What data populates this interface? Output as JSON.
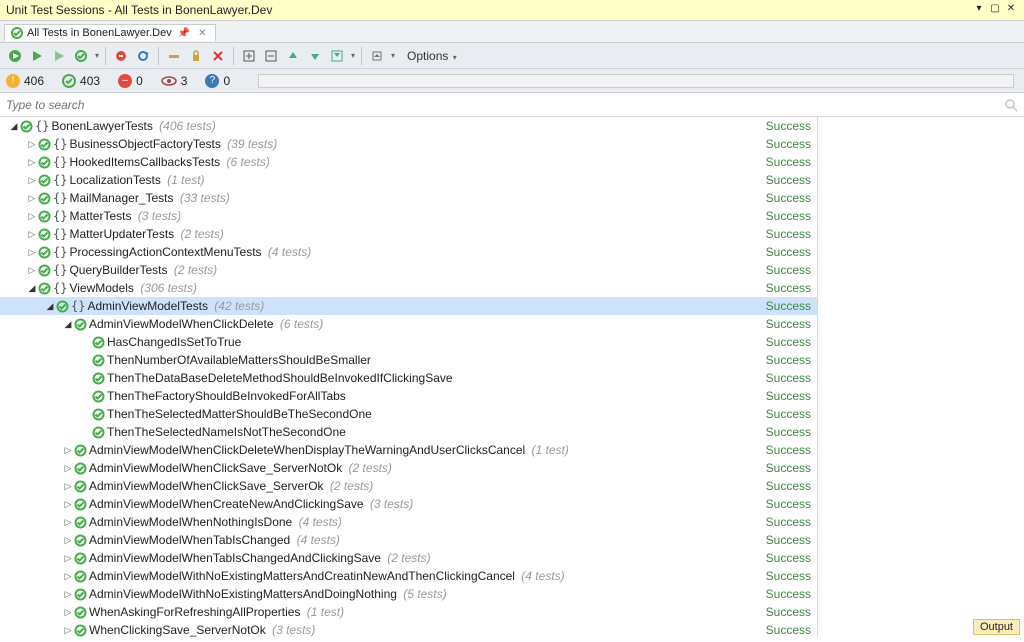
{
  "window_title": "Unit Test Sessions - All Tests in BonenLawyer.Dev",
  "tab_label": "All Tests in BonenLawyer.Dev",
  "options_label": "Options",
  "search_placeholder": "Type to search",
  "status": {
    "warnings": "406",
    "passed": "403",
    "failed": "0",
    "ignored": "3",
    "inconclusive": "0"
  },
  "success_label": "Success",
  "output_label": "Output",
  "tree": [
    {
      "depth": 0,
      "exp": "down",
      "brace": true,
      "name": "BonenLawyerTests",
      "count": "(406 tests)",
      "status": true
    },
    {
      "depth": 1,
      "exp": "right",
      "brace": true,
      "name": "BusinessObjectFactoryTests",
      "count": "(39 tests)",
      "status": true
    },
    {
      "depth": 1,
      "exp": "right",
      "brace": true,
      "name": "HookedItemsCallbacksTests",
      "count": "(6 tests)",
      "status": true
    },
    {
      "depth": 1,
      "exp": "right",
      "brace": true,
      "name": "LocalizationTests",
      "count": "(1 test)",
      "status": true
    },
    {
      "depth": 1,
      "exp": "right",
      "brace": true,
      "name": "MailManager_Tests",
      "count": "(33 tests)",
      "status": true
    },
    {
      "depth": 1,
      "exp": "right",
      "brace": true,
      "name": "MatterTests",
      "count": "(3 tests)",
      "status": true
    },
    {
      "depth": 1,
      "exp": "right",
      "brace": true,
      "name": "MatterUpdaterTests",
      "count": "(2 tests)",
      "status": true
    },
    {
      "depth": 1,
      "exp": "right",
      "brace": true,
      "name": "ProcessingActionContextMenuTests",
      "count": "(4 tests)",
      "status": true
    },
    {
      "depth": 1,
      "exp": "right",
      "brace": true,
      "name": "QueryBuilderTests",
      "count": "(2 tests)",
      "status": true
    },
    {
      "depth": 1,
      "exp": "down",
      "brace": true,
      "name": "ViewModels",
      "count": "(306 tests)",
      "status": true
    },
    {
      "depth": 2,
      "exp": "down",
      "brace": true,
      "name": "AdminViewModelTests",
      "count": "(42 tests)",
      "status": true,
      "selected": true
    },
    {
      "depth": 3,
      "exp": "down",
      "brace": false,
      "name": "AdminViewModelWhenClickDelete",
      "count": "(6 tests)",
      "status": true
    },
    {
      "depth": 4,
      "exp": "",
      "brace": false,
      "name": "HasChangedIsSetToTrue",
      "count": "",
      "status": true
    },
    {
      "depth": 4,
      "exp": "",
      "brace": false,
      "name": "ThenNumberOfAvailableMattersShouldBeSmaller",
      "count": "",
      "status": true
    },
    {
      "depth": 4,
      "exp": "",
      "brace": false,
      "name": "ThenTheDataBaseDeleteMethodShouldBeInvokedIfClickingSave",
      "count": "",
      "status": true
    },
    {
      "depth": 4,
      "exp": "",
      "brace": false,
      "name": "ThenTheFactoryShouldBeInvokedForAllTabs",
      "count": "",
      "status": true
    },
    {
      "depth": 4,
      "exp": "",
      "brace": false,
      "name": "ThenTheSelectedMatterShouldBeTheSecondOne",
      "count": "",
      "status": true
    },
    {
      "depth": 4,
      "exp": "",
      "brace": false,
      "name": "ThenTheSelectedNameIsNotTheSecondOne",
      "count": "",
      "status": true
    },
    {
      "depth": 3,
      "exp": "right",
      "brace": false,
      "name": "AdminViewModelWhenClickDeleteWhenDisplayTheWarningAndUserClicksCancel",
      "count": "(1 test)",
      "status": true
    },
    {
      "depth": 3,
      "exp": "right",
      "brace": false,
      "name": "AdminViewModelWhenClickSave_ServerNotOk",
      "count": "(2 tests)",
      "status": true
    },
    {
      "depth": 3,
      "exp": "right",
      "brace": false,
      "name": "AdminViewModelWhenClickSave_ServerOk",
      "count": "(2 tests)",
      "status": true
    },
    {
      "depth": 3,
      "exp": "right",
      "brace": false,
      "name": "AdminViewModelWhenCreateNewAndClickingSave",
      "count": "(3 tests)",
      "status": true
    },
    {
      "depth": 3,
      "exp": "right",
      "brace": false,
      "name": "AdminViewModelWhenNothingIsDone",
      "count": "(4 tests)",
      "status": true
    },
    {
      "depth": 3,
      "exp": "right",
      "brace": false,
      "name": "AdminViewModelWhenTabIsChanged",
      "count": "(4 tests)",
      "status": true
    },
    {
      "depth": 3,
      "exp": "right",
      "brace": false,
      "name": "AdminViewModelWhenTabIsChangedAndClickingSave",
      "count": "(2 tests)",
      "status": true
    },
    {
      "depth": 3,
      "exp": "right",
      "brace": false,
      "name": "AdminViewModelWithNoExistingMattersAndCreatinNewAndThenClickingCancel",
      "count": "(4 tests)",
      "status": true
    },
    {
      "depth": 3,
      "exp": "right",
      "brace": false,
      "name": "AdminViewModelWithNoExistingMattersAndDoingNothing",
      "count": "(5 tests)",
      "status": true
    },
    {
      "depth": 3,
      "exp": "right",
      "brace": false,
      "name": "WhenAskingForRefreshingAllProperties",
      "count": "(1 test)",
      "status": true
    },
    {
      "depth": 3,
      "exp": "right",
      "brace": false,
      "name": "WhenClickingSave_ServerNotOk",
      "count": "(3 tests)",
      "status": true
    }
  ]
}
